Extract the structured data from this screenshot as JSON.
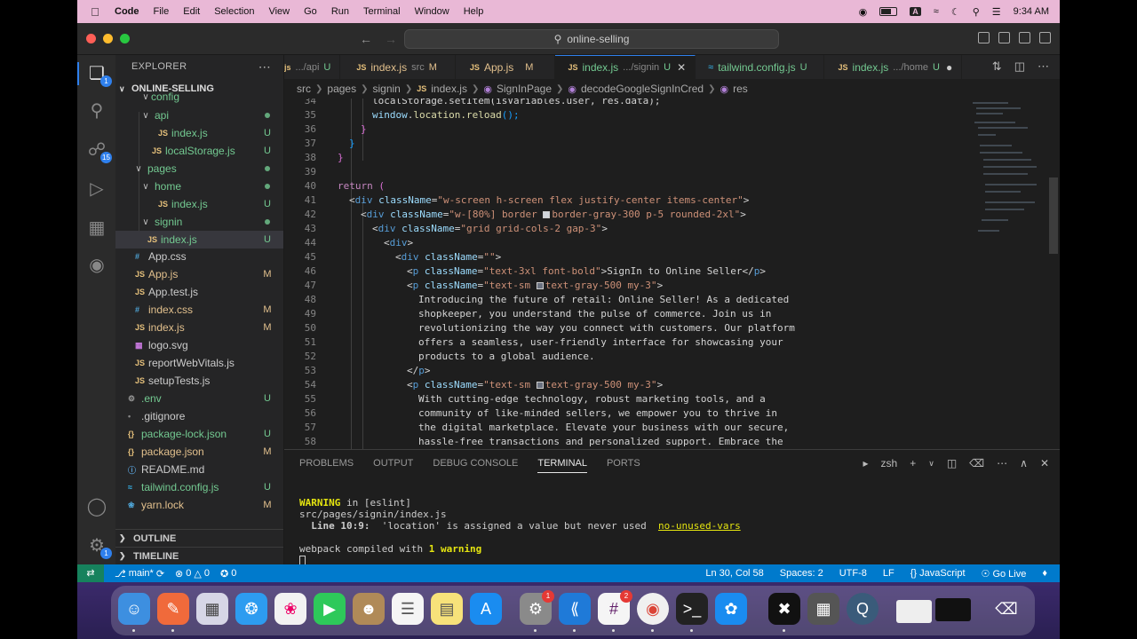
{
  "menubar": {
    "app": "Code",
    "items": [
      "File",
      "Edit",
      "Selection",
      "View",
      "Go",
      "Run",
      "Terminal",
      "Window",
      "Help"
    ],
    "input_badge": "A",
    "time": "9:34 AM"
  },
  "titlebar": {
    "search": "online-selling"
  },
  "activity": {
    "explorer_badge": "1",
    "scm_badge": "15",
    "settings_badge": "1"
  },
  "sidebar": {
    "title": "EXPLORER",
    "root": "ONLINE-SELLING",
    "rows": [
      {
        "name": "config",
        "status": ""
      },
      {
        "name": "api",
        "status": "•"
      },
      {
        "name": "index.js",
        "status": "U"
      },
      {
        "name": "localStorage.js",
        "status": "U"
      },
      {
        "name": "pages",
        "status": "•"
      },
      {
        "name": "home",
        "status": "•"
      },
      {
        "name": "index.js",
        "status": "U"
      },
      {
        "name": "signin",
        "status": "•"
      },
      {
        "name": "index.js",
        "status": "U"
      },
      {
        "name": "App.css",
        "status": ""
      },
      {
        "name": "App.js",
        "status": "M"
      },
      {
        "name": "App.test.js",
        "status": ""
      },
      {
        "name": "index.css",
        "status": "M"
      },
      {
        "name": "index.js",
        "status": "M"
      },
      {
        "name": "logo.svg",
        "status": ""
      },
      {
        "name": "reportWebVitals.js",
        "status": ""
      },
      {
        "name": "setupTests.js",
        "status": ""
      },
      {
        "name": ".env",
        "status": "U"
      },
      {
        "name": ".gitignore",
        "status": ""
      },
      {
        "name": "package-lock.json",
        "status": "U"
      },
      {
        "name": "package.json",
        "status": "M"
      },
      {
        "name": "README.md",
        "status": ""
      },
      {
        "name": "tailwind.config.js",
        "status": "U"
      },
      {
        "name": "yarn.lock",
        "status": "M"
      }
    ],
    "outline": "OUTLINE",
    "timeline": "TIMELINE"
  },
  "tabs": [
    {
      "name": "js",
      "desc": ".../api",
      "status": "U"
    },
    {
      "name": "index.js",
      "desc": "src",
      "status": "M"
    },
    {
      "name": "App.js",
      "desc": "",
      "status": "M"
    },
    {
      "name": "index.js",
      "desc": ".../signin",
      "status": "U"
    },
    {
      "name": "tailwind.config.js",
      "desc": "",
      "status": "U"
    },
    {
      "name": "index.js",
      "desc": ".../home",
      "status": "U"
    }
  ],
  "breadcrumb": [
    "src",
    "pages",
    "signin",
    "index.js",
    "SignInPage",
    "decodeGoogleSignInCred",
    "res"
  ],
  "editor": {
    "line_numbers": [
      "34",
      "35",
      "36",
      "37",
      "38",
      "39",
      "40",
      "41",
      "42",
      "43",
      "44",
      "45",
      "46",
      "47",
      "48",
      "49",
      "50",
      "51",
      "52",
      "53",
      "54",
      "55",
      "56",
      "57",
      "58"
    ],
    "line34": "localStorage.setItem(isVariables.user, res.data);",
    "line35_obj": "window",
    "line35_fn": "location.reload",
    "line35_tail": "();",
    "line40_kw": "return",
    "line41_cls": "\"w-screen h-screen flex justify-center items-center\"",
    "line42_cls_a": "\"w-[80%] border ",
    "line42_cls_b": "border-gray-300 p-5 rounded-2xl\"",
    "line43_cls": "\"grid grid-cols-2 gap-3\"",
    "line45_cls": "\"\"",
    "line46_cls": "\"text-3xl font-bold\"",
    "line46_text": "SignIn to Online Seller",
    "line47_cls_a": "\"text-sm ",
    "line47_cls_b": "text-gray-500 my-3\"",
    "line48": "Introducing the future of retail: Online Seller! As a dedicated",
    "line49": "shopkeeper, you understand the pulse of commerce. Join us in",
    "line50": "revolutionizing the way you connect with customers. Our platform",
    "line51": "offers a seamless, user-friendly interface for showcasing your",
    "line52": "products to a global audience.",
    "line54_cls_a": "\"text-sm ",
    "line54_cls_b": "text-gray-500 my-3\"",
    "line55": "With cutting-edge technology, robust marketing tools, and a",
    "line56": "community of like-minded sellers, we empower you to thrive in",
    "line57": "the digital marketplace. Elevate your business with our secure,",
    "line58": "hassle-free transactions and personalized support. Embrace the"
  },
  "panel": {
    "tabs": [
      "PROBLEMS",
      "OUTPUT",
      "DEBUG CONSOLE",
      "TERMINAL",
      "PORTS"
    ],
    "shell": "zsh",
    "terminal": {
      "warn_label": "WARNING",
      "warn_rest": " in [eslint]",
      "path": "src/pages/signin/index.js",
      "line_ref": "  Line 10:9:  ",
      "msg": "'location' is assigned a value but never used  ",
      "rule": "no-unused-vars",
      "compiled_a": "webpack compiled with ",
      "compiled_b": "1 warning"
    }
  },
  "statusbar": {
    "branch": "main*",
    "errors": "0",
    "warnings": "0",
    "ports": "0",
    "position": "Ln 30, Col 58",
    "spaces": "Spaces: 2",
    "encoding": "UTF-8",
    "eol": "LF",
    "language": "JavaScript",
    "golive": "Go Live"
  },
  "dock": {
    "settings_badge": "1",
    "slack_badge": "2"
  },
  "colors": {
    "accent": "#007acc",
    "menubar": "#e9b8d6",
    "untracked": "#73c991",
    "modified": "#e2c08d"
  }
}
